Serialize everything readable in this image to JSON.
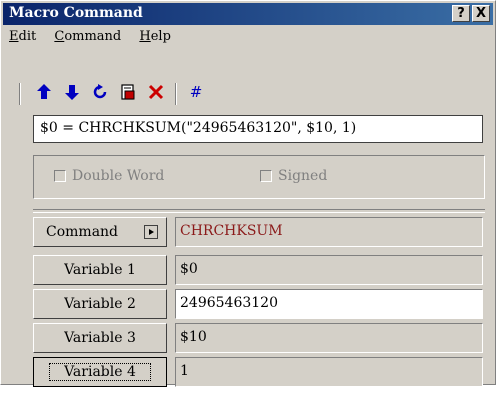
{
  "window": {
    "title": "Macro Command",
    "help_btn": "?",
    "close_btn": "X"
  },
  "menu": [
    {
      "pre": "",
      "u": "E",
      "post": "dit"
    },
    {
      "pre": "",
      "u": "C",
      "post": "ommand"
    },
    {
      "pre": "",
      "u": "H",
      "post": "elp"
    }
  ],
  "toolbar": {
    "icons": [
      "up-arrow-icon",
      "down-arrow-icon",
      "undo-icon",
      "copy-page-icon",
      "delete-icon",
      "hash-icon"
    ],
    "hash_label": "#"
  },
  "command_text": "$0 = CHRCHKSUM(\"24965463120\", $10, 1)",
  "options": {
    "double_word": "Double Word",
    "signed": "Signed"
  },
  "rows": {
    "command_label": "Command",
    "command_value": "CHRCHKSUM",
    "var1_label": "Variable 1",
    "var1_value": "$0",
    "var2_label": "Variable 2",
    "var2_value": "24965463120",
    "var3_label": "Variable 3",
    "var3_value": "$10",
    "var4_label": "Variable 4",
    "var4_value": "1"
  },
  "colors": {
    "command_value": "#8b1a1a",
    "title_bar": "#0a246a",
    "toolbar_icon": "#0000c0",
    "delete_icon": "#cc0000"
  }
}
